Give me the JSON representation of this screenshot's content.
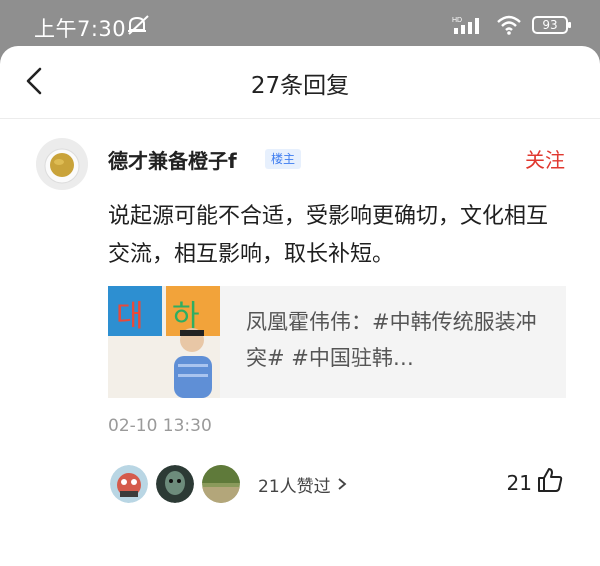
{
  "status_bar": {
    "time": "上午7:30",
    "battery": "93",
    "network_badge": "HD"
  },
  "header": {
    "title": "27条回复"
  },
  "comment": {
    "username": "德才兼备橙子f",
    "badge": "楼主",
    "follow_label": "关注",
    "text": "说起源可能不合适，受影响更确切，文化相互交流，相互影响，取长补短。",
    "quote": {
      "text": "凤凰霍伟伟：#中韩传统服装冲突# #中国驻韩…",
      "thumb_glyphs": [
        "대",
        "하"
      ]
    },
    "timestamp": "02-10 13:30",
    "likers_label": "21人赞过",
    "like_count": "21"
  },
  "colors": {
    "accent_red": "#e0382f",
    "badge_blue": "#3d7cf0",
    "status_bar_bg": "#8f8f8f"
  },
  "icons": [
    "back-chevron-icon",
    "mute-icon",
    "signal-icon",
    "wifi-icon",
    "battery-icon",
    "chevron-right-icon",
    "thumbs-up-icon"
  ]
}
